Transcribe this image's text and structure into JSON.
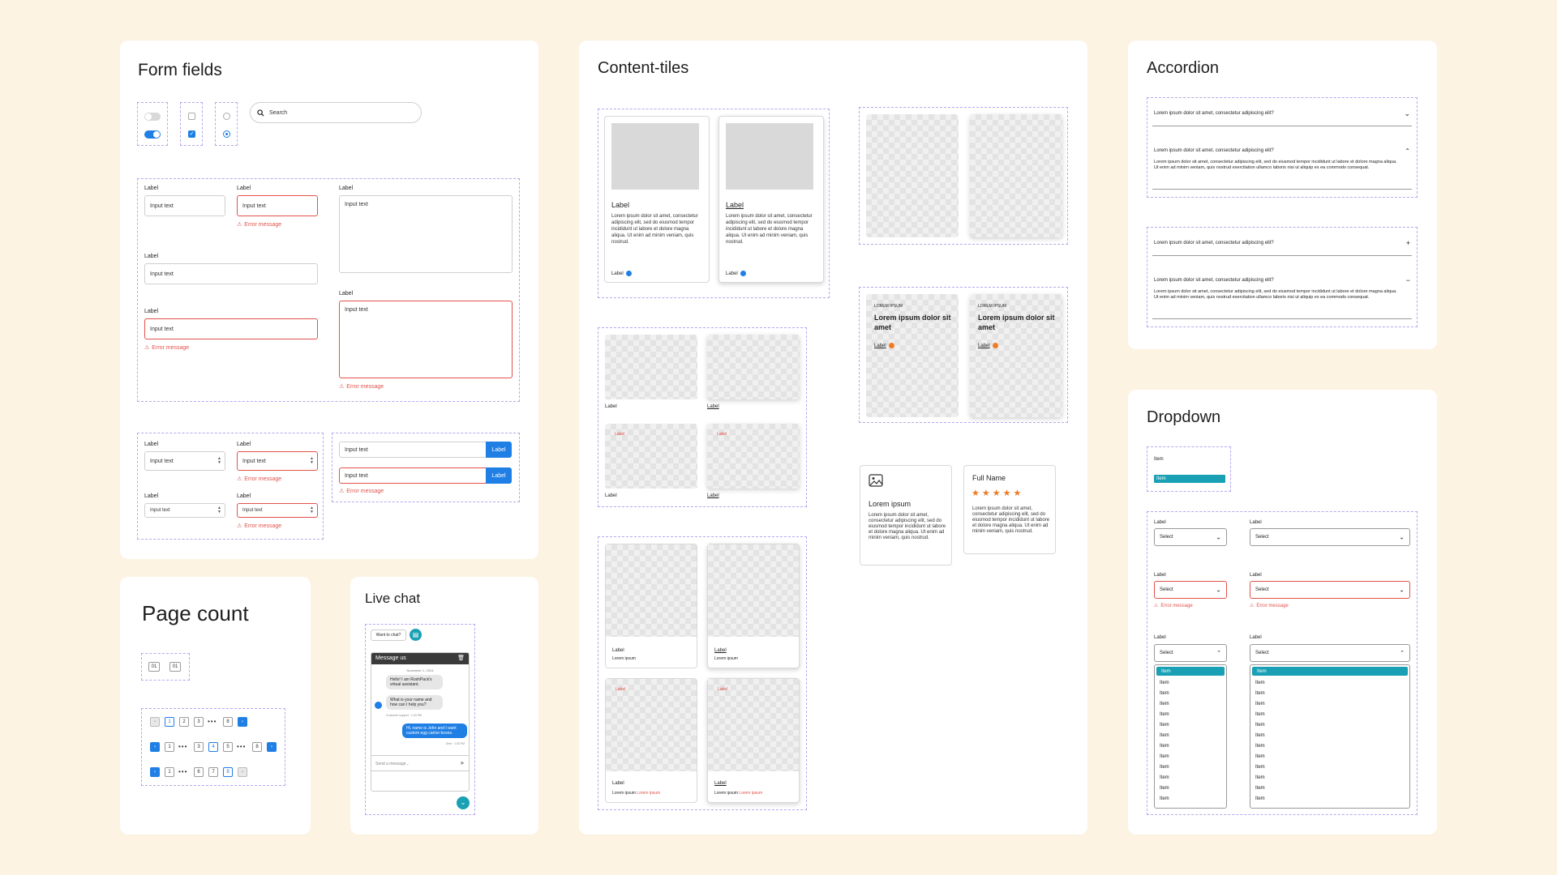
{
  "form_fields": {
    "title": "Form fields",
    "search_placeholder": "Search",
    "label": "Label",
    "input_text": "Input text",
    "error_message": "Error message"
  },
  "content_tiles": {
    "title": "Content-tiles",
    "label": "Label",
    "body": "Lorem ipsum dolor sit amet, consectetur adipiscing elit, sed do eiusmod tempor incididunt ut labore et dolore magna aliqua. Ut enim ad minim veniam, quis nostrud.",
    "lorem_ipsum": "Lorem ipsum",
    "overline": "LOREM IPSUM",
    "tile_heading": "Lorem ipsum dolor sit amet",
    "info_title": "Lorem ipsum",
    "info_body": "Lorem ipsum dolor sit amet, consectetur adipiscing elit, sed do eiusmod tempor incididunt ut labore et dolore magna aliqua. Ut enim ad minim veniam, quis nostrud.",
    "review_name": "Full Name",
    "review_rating": 5,
    "review_body": "Lorem ipsum dolor sit amet, consectetur adipiscing elit, sed do eiusmod tempor incididunt ut labore et dolore magna aliqua. Ut enim ad minim veniam, quis nostrud."
  },
  "accordion": {
    "title": "Accordion",
    "question": "Lorem ipsum dolor sit amet, consectetur adipiscing elit?",
    "answer": "Lorem ipsum dolor sit amet, consectetur adipiscing elit, sed do eiusmod tempor incididunt ut labore et dolore magna aliqua. Ut enim ad minim veniam, quis nostrud exercitation ullamco laboris nisi ut aliquip ex ea commodo consequat."
  },
  "dropdown": {
    "title": "Dropdown",
    "item": "Item",
    "label": "Label",
    "select": "Select",
    "error_message": "Error message"
  },
  "page_count": {
    "title": "Page count",
    "current": "01",
    "total": "01",
    "row1": [
      "1",
      "2",
      "3",
      "8"
    ],
    "row2": [
      "1",
      "3",
      "4",
      "5",
      "8"
    ],
    "row3": [
      "1",
      "6",
      "7",
      "8"
    ],
    "ellipsis": "•••"
  },
  "live_chat": {
    "title": "Live chat",
    "prompt": "Want to chat?",
    "header": "Message us",
    "date": "November 1, 2024",
    "bot_msg1": "Hello! I am RoshPack's virtual assistant.",
    "bot_msg2": "What is your name and how can I help you?",
    "bot_meta": "Customer support · 1:34 PM",
    "user_msg": "Hi, name is John and I want custom egg carton boxes.",
    "user_meta": "Sent · 1:35 PM",
    "placeholder": "Send a message..."
  },
  "colors": {
    "accent": "#1f7fe5",
    "error": "#e2524a",
    "teal": "#1aa0b4",
    "orange": "#f07a23"
  }
}
